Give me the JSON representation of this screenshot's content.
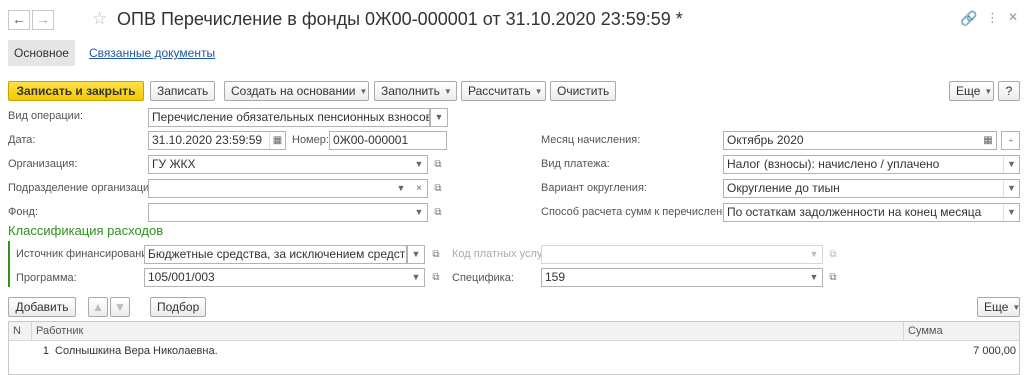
{
  "window": {
    "title": "ОПВ Перечисление в фонды 0Ж00-000001 от 31.10.2020 23:59:59 *"
  },
  "tabs": {
    "main": "Основное",
    "related": "Связанные документы"
  },
  "toolbar": {
    "save_close": "Записать и закрыть",
    "save": "Записать",
    "create_basis": "Создать на основании",
    "fill": "Заполнить",
    "calculate": "Рассчитать",
    "clear": "Очистить",
    "more": "Еще",
    "help": "?"
  },
  "form": {
    "operation_type": {
      "label": "Вид операции:",
      "value": "Перечисление обязательных пенсионных взносов"
    },
    "date": {
      "label": "Дата:",
      "value": "31.10.2020 23:59:59"
    },
    "number": {
      "label": "Номер:",
      "value": "0Ж00-000001"
    },
    "organization": {
      "label": "Организация:",
      "value": "ГУ ЖКХ"
    },
    "subdivision": {
      "label": "Подразделение организации:",
      "value": ""
    },
    "fund": {
      "label": "Фонд:",
      "value": ""
    },
    "accrual_month": {
      "label": "Месяц начисления:",
      "value": "Октябрь 2020"
    },
    "payment_type": {
      "label": "Вид платежа:",
      "value": "Налог (взносы): начислено / уплачено"
    },
    "rounding": {
      "label": "Вариант округления:",
      "value": "Округление до тиын"
    },
    "calc_method": {
      "label": "Способ расчета сумм к перечислению:",
      "value": "По остаткам задолженности на конец месяца"
    }
  },
  "classification": {
    "title": "Классификация расходов",
    "funding_source": {
      "label": "Источник финансирования:",
      "value": "Бюджетные средства, за исключением средств"
    },
    "paid_services_code": {
      "label": "Код платных услуг:",
      "value": ""
    },
    "program": {
      "label": "Программа:",
      "value": "105/001/003"
    },
    "specifics": {
      "label": "Специфика:",
      "value": "159"
    }
  },
  "table_toolbar": {
    "add": "Добавить",
    "selection": "Подбор",
    "more": "Еще"
  },
  "table": {
    "columns": {
      "n": "N",
      "employee": "Работник",
      "amount": "Сумма"
    },
    "rows": [
      {
        "n": "1",
        "employee": "Солнышкина Вера Николаевна.",
        "amount": "7 000,00"
      }
    ]
  }
}
